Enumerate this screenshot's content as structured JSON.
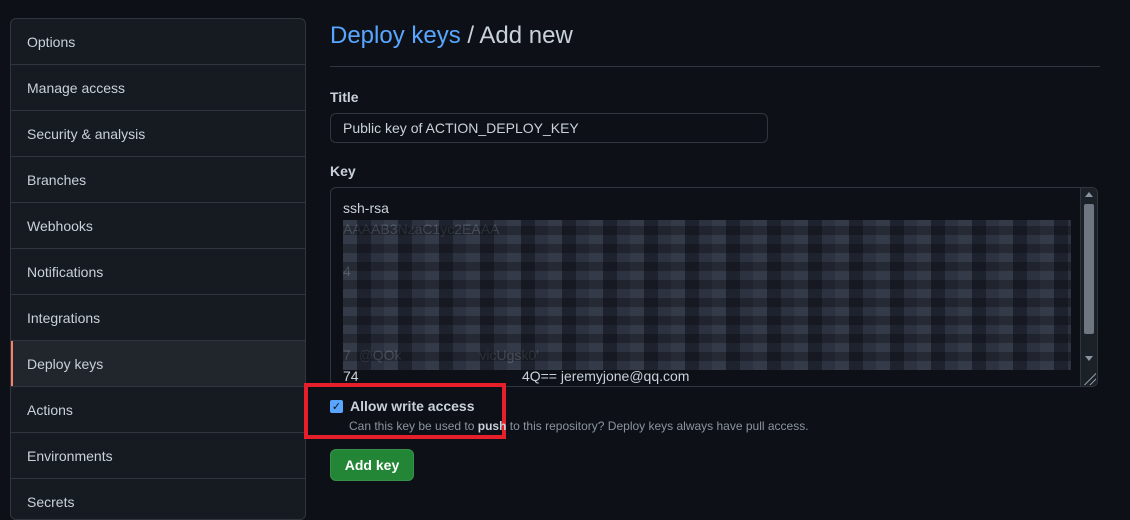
{
  "sidebar": {
    "items": [
      {
        "label": "Options"
      },
      {
        "label": "Manage access"
      },
      {
        "label": "Security & analysis"
      },
      {
        "label": "Branches"
      },
      {
        "label": "Webhooks"
      },
      {
        "label": "Notifications"
      },
      {
        "label": "Integrations"
      },
      {
        "label": "Deploy keys",
        "active": true
      },
      {
        "label": "Actions"
      },
      {
        "label": "Environments"
      },
      {
        "label": "Secrets"
      }
    ]
  },
  "header": {
    "breadcrumb_link": "Deploy keys",
    "separator": " / ",
    "page": "Add new"
  },
  "form": {
    "title_label": "Title",
    "title_value": "Public key of ACTION_DEPLOY_KEY",
    "key_label": "Key",
    "key_value": "ssh-rsa\nAAAAB3NzaC1yc2EAAA\n\n4\n\n\n\n7  @QOk                    vicUgsk0'\n74                                          4Q== jeremyjone@qq.com",
    "allow_write_label": "Allow write access",
    "allow_write_checked": true,
    "help_prefix": "Can this key be used to ",
    "help_bold": "push",
    "help_suffix": " to this repository? Deploy keys always have pull access.",
    "submit_label": "Add key"
  },
  "colors": {
    "accent": "#58a6ff",
    "success": "#238636",
    "highlight": "#e5202a"
  }
}
